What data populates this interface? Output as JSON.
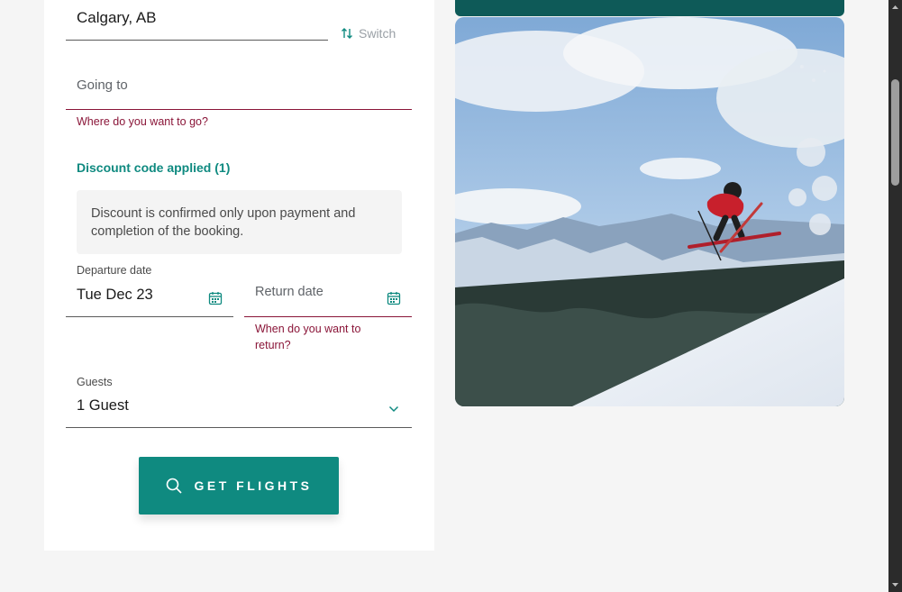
{
  "form": {
    "from_value": "Calgary, AB",
    "switch_label": "Switch",
    "going_to_placeholder": "Going to",
    "going_to_error": "Where do you want to go?",
    "discount_link": "Discount code applied (1)",
    "discount_note": "Discount is confirmed only upon payment and completion of the booking.",
    "departure_label": "Departure date",
    "departure_value": "Tue Dec 23",
    "return_placeholder": "Return date",
    "return_error": "When do you want to return?",
    "guests_label": "Guests",
    "guests_value": "1 Guest",
    "cta_label": "GET FLIGHTS"
  },
  "icons": {
    "switch": "swap-vertical-icon",
    "calendar": "calendar-icon",
    "chevron": "chevron-down-icon",
    "search": "search-icon"
  },
  "colors": {
    "accent": "#0f8a80",
    "error": "#8a1538",
    "dark_teal": "#0e5a58",
    "background": "#f5f5f5"
  }
}
